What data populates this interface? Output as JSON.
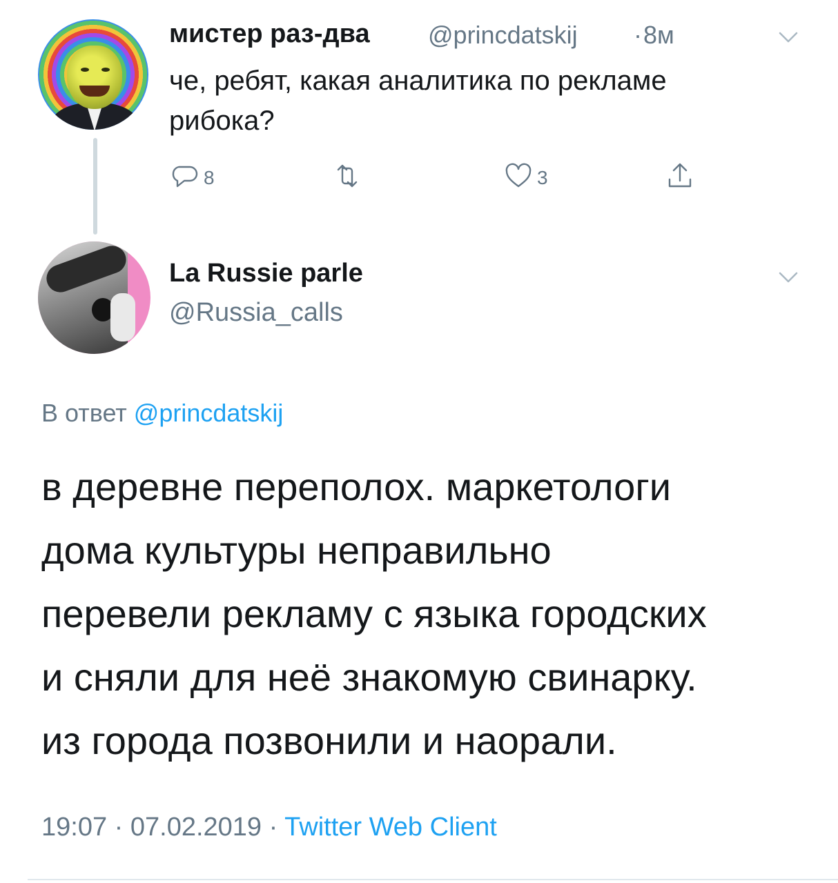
{
  "parent_tweet": {
    "author_name": "мистер раз-два",
    "author_handle": "@princdatskij",
    "separator": "·",
    "time_ago": "8м",
    "text_line1": "че, ребят, какая аналитика по рекламе",
    "text_line2": "рибока?",
    "reply_count": "8",
    "retweet_count": "",
    "like_count": "3"
  },
  "main_tweet": {
    "author_name": "La Russie parle",
    "author_handle": "@Russia_calls",
    "reply_prefix": "В ответ",
    "reply_mention": "@princdatskij",
    "lines": [
      "в деревне переполох. маркетологи",
      "дома культуры неправильно",
      "перевели рекламу с языка городских",
      "и сняли для неё знакомую свинарку.",
      "из города позвонили и наорали."
    ],
    "time": "19:07",
    "date": "07.02.2019",
    "meta_sep": "·",
    "source": "Twitter Web Client"
  },
  "icons": {
    "reply": "reply-icon",
    "retweet": "retweet-icon",
    "like": "heart-icon",
    "share": "share-icon",
    "more": "chevron-down-icon"
  },
  "colors": {
    "link": "#1da1f2",
    "secondary": "#657786",
    "text": "#14171a"
  }
}
